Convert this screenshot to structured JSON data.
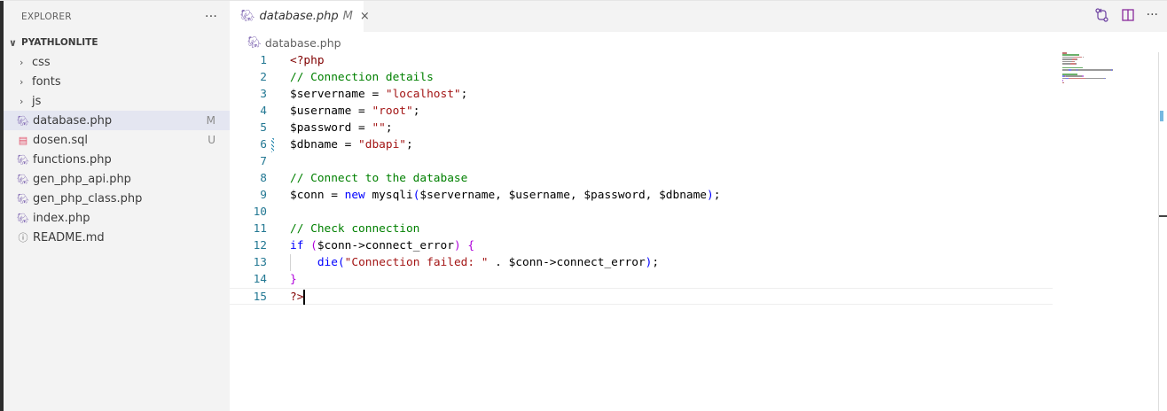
{
  "sidebar": {
    "title": "EXPLORER",
    "more": "···",
    "project": "PYATHLONLITE",
    "folders": [
      "css",
      "fonts",
      "js"
    ],
    "files": [
      {
        "name": "database.php",
        "icon": "php-elephant-icon",
        "badge": "M"
      },
      {
        "name": "dosen.sql",
        "icon": "database-icon",
        "badge": "U"
      },
      {
        "name": "functions.php",
        "icon": "php-elephant-icon",
        "badge": ""
      },
      {
        "name": "gen_php_api.php",
        "icon": "php-elephant-icon",
        "badge": ""
      },
      {
        "name": "gen_php_class.php",
        "icon": "php-elephant-icon",
        "badge": ""
      },
      {
        "name": "index.php",
        "icon": "php-elephant-icon",
        "badge": ""
      },
      {
        "name": "README.md",
        "icon": "info-icon",
        "badge": ""
      }
    ]
  },
  "tab": {
    "label": "database.php",
    "modified": "M",
    "close": "×"
  },
  "breadcrumb": "database.php",
  "colors": {
    "accent": "#1b81a8",
    "php": "#8a74b8",
    "sql": "#e04e68"
  },
  "code": [
    [
      [
        "<?php",
        "p"
      ]
    ],
    [
      [
        "// Connection details",
        "c"
      ]
    ],
    [
      [
        "$servername = ",
        ""
      ],
      [
        "\"localhost\"",
        "s"
      ],
      [
        ";",
        ""
      ]
    ],
    [
      [
        "$username = ",
        ""
      ],
      [
        "\"root\"",
        "s"
      ],
      [
        ";",
        ""
      ]
    ],
    [
      [
        "$password = ",
        ""
      ],
      [
        "\"\"",
        "s"
      ],
      [
        ";",
        ""
      ]
    ],
    [
      [
        "$dbname = ",
        ""
      ],
      [
        "\"dbapi\"",
        "s"
      ],
      [
        ";",
        ""
      ]
    ],
    [],
    [
      [
        "// Connect to the database",
        "c"
      ]
    ],
    [
      [
        "$conn = ",
        ""
      ],
      [
        "new",
        "k"
      ],
      [
        " mysqli",
        ""
      ],
      [
        "(",
        "k"
      ],
      [
        "$servername, $username, $password, $dbname",
        ""
      ],
      [
        ")",
        "k"
      ],
      [
        ";",
        ""
      ]
    ],
    [],
    [
      [
        "// Check connection",
        "c"
      ]
    ],
    [
      [
        "if",
        "k"
      ],
      [
        " ",
        ""
      ],
      [
        "(",
        "pu"
      ],
      [
        "$conn->connect_error",
        ""
      ],
      [
        ")",
        "pu"
      ],
      [
        " ",
        ""
      ],
      [
        "{",
        "pu"
      ]
    ],
    [
      [
        "    ",
        ""
      ],
      [
        "die",
        "k"
      ],
      [
        "(",
        "k"
      ],
      [
        "\"Connection failed: \"",
        "s"
      ],
      [
        " . $conn->connect_error",
        ""
      ],
      [
        ")",
        "k"
      ],
      [
        ";",
        ""
      ]
    ],
    [
      [
        "}",
        "pu"
      ]
    ],
    [
      [
        "?>",
        "p"
      ]
    ]
  ]
}
